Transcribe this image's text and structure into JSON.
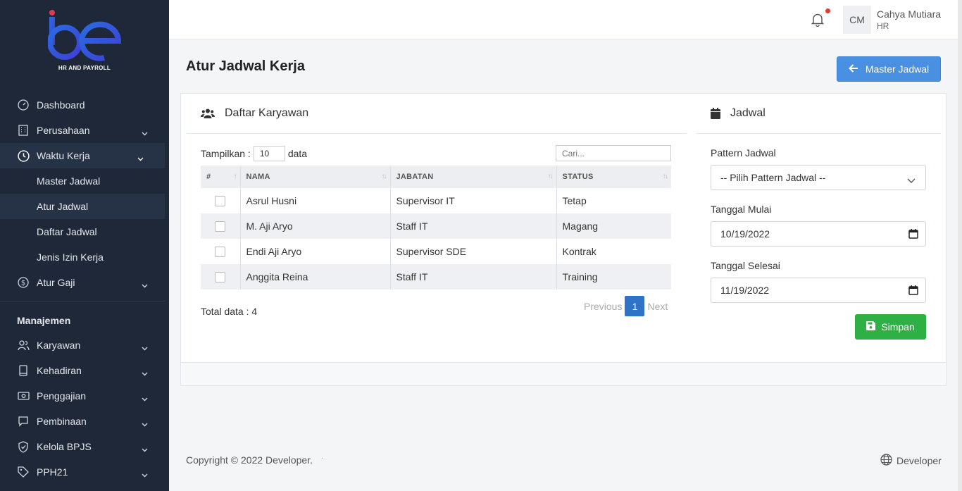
{
  "brand": {
    "logo_text": "be",
    "tagline": "HR AND PAYROLL"
  },
  "sidebar": {
    "items": [
      {
        "label": "Dashboard",
        "icon": "dashboard-icon"
      },
      {
        "label": "Perusahaan",
        "icon": "building-icon"
      },
      {
        "label": "Waktu Kerja",
        "icon": "clock-icon"
      }
    ],
    "sub_items": [
      "Master Jadwal",
      "Atur Jadwal",
      "Daftar Jadwal",
      "Jenis Izin Kerja"
    ],
    "items2": [
      {
        "label": "Atur Gaji",
        "icon": "dollar-icon"
      }
    ],
    "section_title": "Manajemen",
    "manage_items": [
      {
        "label": "Karyawan",
        "icon": "users-icon"
      },
      {
        "label": "Kehadiran",
        "icon": "book-icon"
      },
      {
        "label": "Penggajian",
        "icon": "money-icon"
      },
      {
        "label": "Pembinaan",
        "icon": "chat-icon"
      },
      {
        "label": "Kelola BPJS",
        "icon": "shield-icon"
      },
      {
        "label": "PPH21",
        "icon": "tag-icon"
      }
    ]
  },
  "topbar": {
    "avatar_initials": "CM",
    "user_name": "Cahya Mutiara",
    "user_role": "HR"
  },
  "page": {
    "title": "Atur Jadwal Kerja",
    "master_button": "Master Jadwal"
  },
  "employees": {
    "title": "Daftar Karyawan",
    "show_label": "Tampilkan :",
    "show_value": "10",
    "show_suffix": "data",
    "search_placeholder": "Cari...",
    "columns": [
      "#",
      "NAMA",
      "JABATAN",
      "STATUS"
    ],
    "rows": [
      {
        "name": "Asrul Husni",
        "position": "Supervisor IT",
        "status": "Tetap"
      },
      {
        "name": "M. Aji Aryo",
        "position": "Staff IT",
        "status": "Magang"
      },
      {
        "name": "Endi Aji Aryo",
        "position": "Supervisor SDE",
        "status": "Kontrak"
      },
      {
        "name": "Anggita Reina",
        "position": "Staff IT",
        "status": "Training"
      }
    ],
    "total_label": "Total data : 4",
    "pagination": {
      "previous": "Previous",
      "current": "1",
      "next": "Next"
    }
  },
  "schedule": {
    "title": "Jadwal",
    "pattern_label": "Pattern Jadwal",
    "pattern_value": "-- Pilih Pattern Jadwal --",
    "start_label": "Tanggal Mulai",
    "start_value": "10/19/2022",
    "end_label": "Tanggal Selesai",
    "end_value": "11/19/2022",
    "save_button": "Simpan"
  },
  "footer": {
    "copyright": "Copyright © 2022 Developer.",
    "separator": "·",
    "link": "Developer"
  },
  "colors": {
    "sidebar_bg": "#1e2838",
    "primary": "#4a90e2",
    "page_active": "#2f73c9",
    "success": "#2eb045",
    "notification": "#e53935"
  }
}
